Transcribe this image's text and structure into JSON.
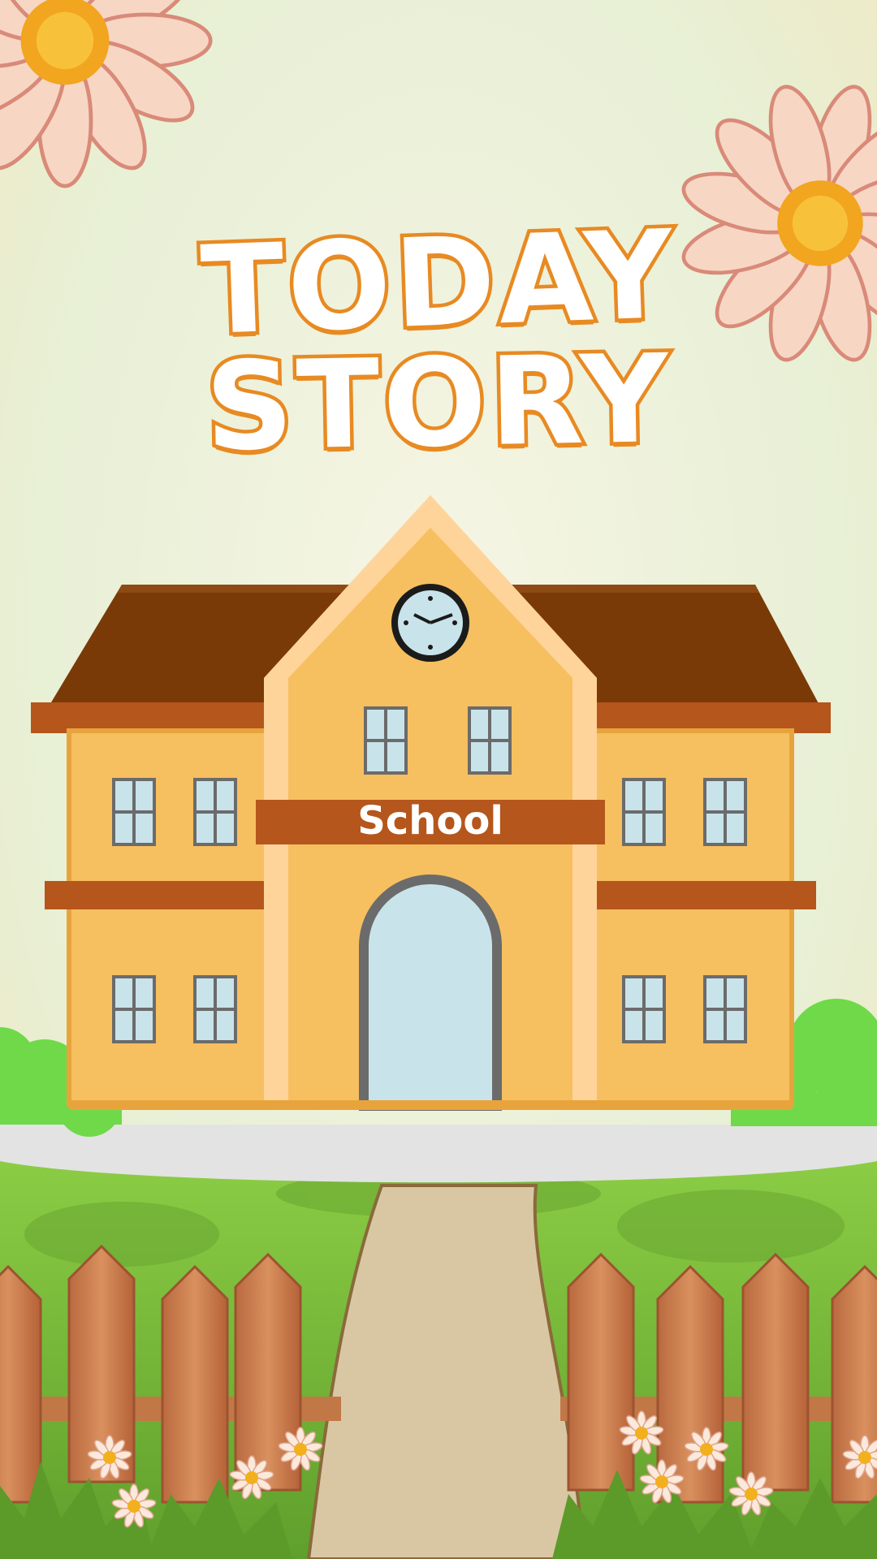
{
  "title": {
    "line1": "TODAY",
    "line2": "STORY"
  },
  "building": {
    "sign": "School"
  },
  "colors": {
    "background": "#eef2d8",
    "title_outline": "#e88a22",
    "wall": "#f6bf60",
    "roof": "#7a3a08",
    "trim": "#b5561c",
    "window": "#c9e3ea",
    "grass": "#7cbf3a",
    "fence": "#c97a4a",
    "path": "#d9c7a4",
    "flower_petal": "#f7d6c4",
    "flower_center": "#f2a51e"
  },
  "icons": [
    "daisy-flower-icon",
    "clock-icon",
    "bush-icon",
    "picket-fence-icon"
  ]
}
